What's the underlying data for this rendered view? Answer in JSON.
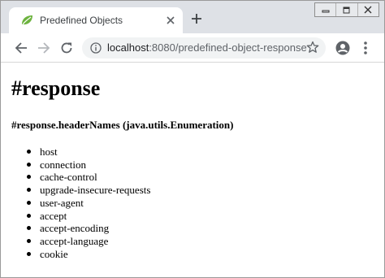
{
  "browser": {
    "tab": {
      "title": "Predefined Objects",
      "favicon": "spring-leaf-icon"
    },
    "new_tab_icon": "plus-icon",
    "window_controls": [
      "minimize-icon",
      "restore-icon",
      "close-icon"
    ],
    "address_bar": {
      "host": "localhost",
      "path": ":8080/predefined-object-response"
    },
    "colors": {
      "tab_strip": "#dee1e6",
      "omnibox": "#f1f3f4",
      "favicon_green": "#6db33f"
    }
  },
  "page": {
    "heading": "#response",
    "subheading": "#response.headerNames (java.utils.Enumeration)",
    "header_names": [
      "host",
      "connection",
      "cache-control",
      "upgrade-insecure-requests",
      "user-agent",
      "accept",
      "accept-encoding",
      "accept-language",
      "cookie"
    ]
  }
}
